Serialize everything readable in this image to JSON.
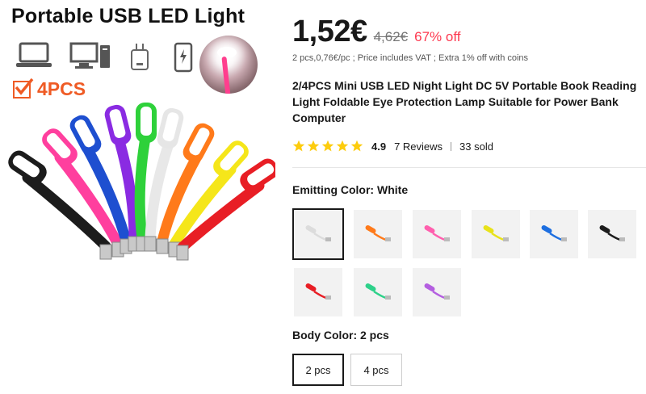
{
  "hero": {
    "title": "Portable USB LED Light",
    "qty_badge": "4PCS",
    "device_icons": [
      "laptop-icon",
      "desktop-computer-icon",
      "wall-charger-icon",
      "power-bank-icon"
    ],
    "lamp_colors": [
      "#1c1c1c",
      "#ff3f9e",
      "#1e4fd0",
      "#8a2be2",
      "#2ed13a",
      "#f4f4f4",
      "#ff7a1a",
      "#f5e61a",
      "#e81e25"
    ]
  },
  "price": {
    "current": "1,52€",
    "original": "4,62€",
    "discount": "67% off",
    "sub": "2 pcs,0,76€/pc ; Price includes VAT ; Extra 1% off with coins"
  },
  "product": {
    "title": "2/4PCS Mini USB LED Night Light DC 5V Portable Book Reading Light Foldable Eye Protection Lamp Suitable for Power Bank Computer"
  },
  "rating": {
    "score": "4.9",
    "stars": 5,
    "reviews": "7 Reviews",
    "sold": "33 sold"
  },
  "emitting_color": {
    "label": "Emitting Color: ",
    "value": "White",
    "options": [
      {
        "color": "#dcdcdc",
        "selected": true
      },
      {
        "color": "#ff7a1a",
        "selected": false
      },
      {
        "color": "#ff5fae",
        "selected": false
      },
      {
        "color": "#e8e21a",
        "selected": false
      },
      {
        "color": "#1e6fe0",
        "selected": false
      },
      {
        "color": "#1c1c1c",
        "selected": false
      },
      {
        "color": "#e81e25",
        "selected": false
      },
      {
        "color": "#2ed18a",
        "selected": false
      },
      {
        "color": "#b45fe0",
        "selected": false
      }
    ]
  },
  "body_color": {
    "label": "Body Color: ",
    "value": "2 pcs",
    "options": [
      {
        "label": "2 pcs",
        "selected": true
      },
      {
        "label": "4 pcs",
        "selected": false
      }
    ]
  },
  "colors": {
    "discount_red": "#fd384f",
    "star_yellow": "#fdcc0d",
    "badge_orange": "#ef5b25"
  }
}
